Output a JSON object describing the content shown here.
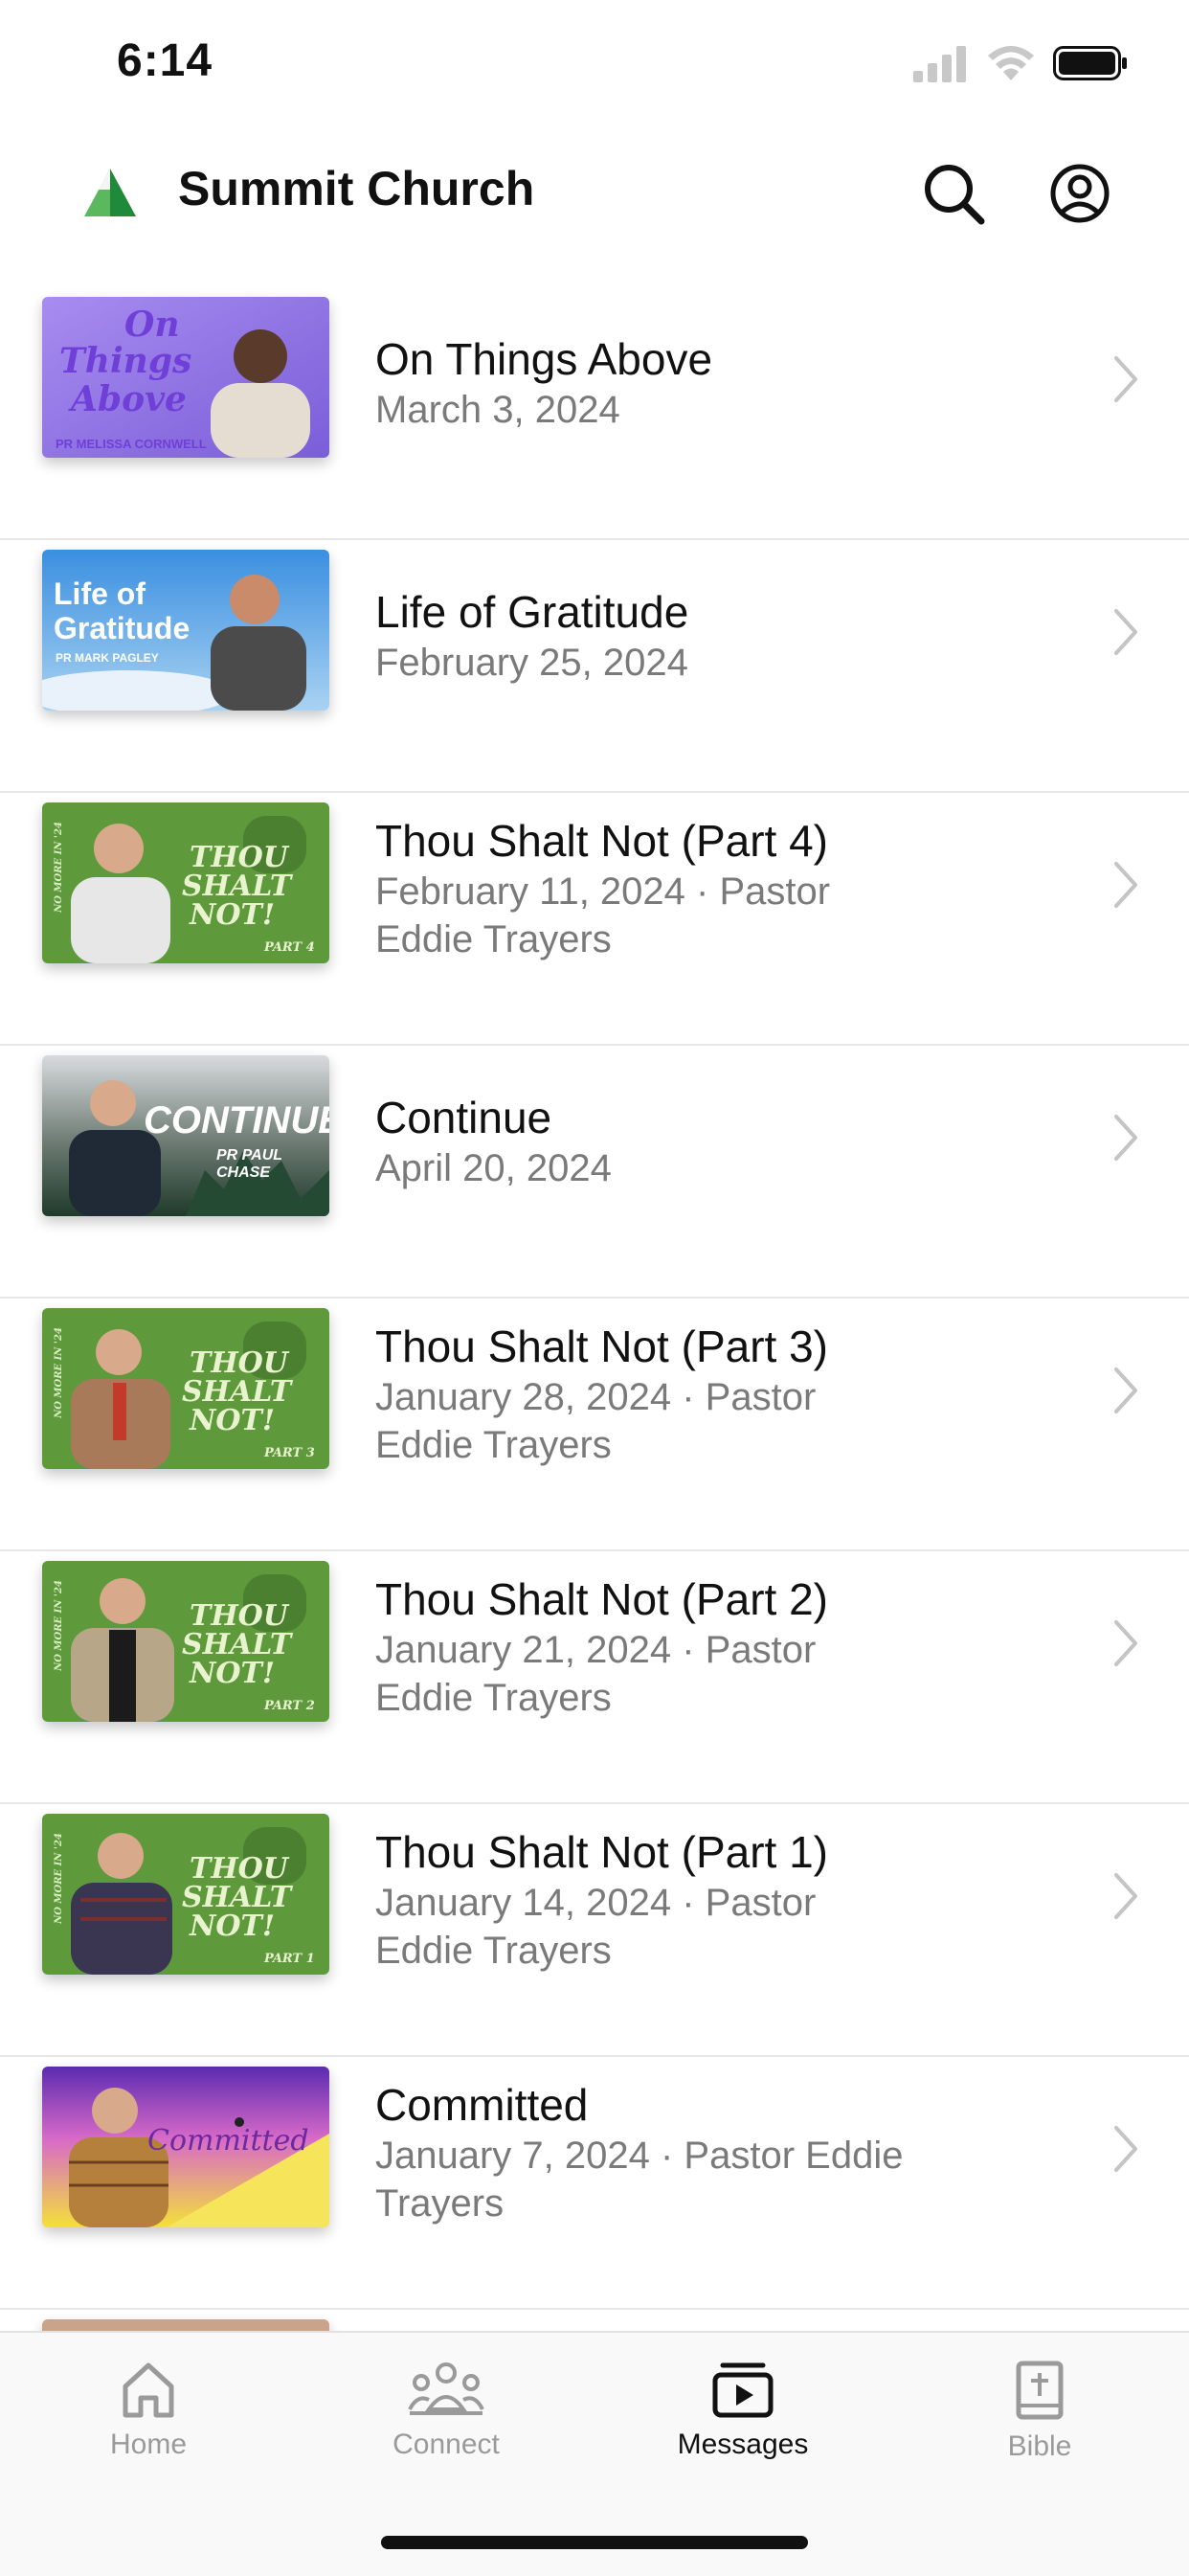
{
  "status_bar": {
    "time": "6:14"
  },
  "header": {
    "title": "Summit Church",
    "search_icon": "search-icon",
    "profile_icon": "profile-icon",
    "logo": "summit-church-logo"
  },
  "messages": [
    {
      "title": "On Things Above",
      "subtitle": "March 3, 2024",
      "thumbnail": {
        "text1": "On",
        "text2": "Things",
        "text3": "Above",
        "caption": "PR MELISSA CORNWELL"
      }
    },
    {
      "title": "Life of Gratitude",
      "subtitle": "February 25, 2024",
      "thumbnail": {
        "text1": "Life of",
        "text2": "Gratitude",
        "caption": "PR MARK PAGLEY"
      }
    },
    {
      "title": "Thou Shalt Not (Part 4)",
      "subtitle": "February 11, 2024 · Pastor Eddie Trayers",
      "thumbnail": {
        "text1": "THOU",
        "text2": "SHALT",
        "text3": "NOT!",
        "caption": "PART 4",
        "side": "NO MORE IN '24"
      }
    },
    {
      "title": "Continue",
      "subtitle": "April 20, 2024",
      "thumbnail": {
        "text1": "CONTINUE",
        "caption": "PR PAUL CHASE"
      }
    },
    {
      "title": "Thou Shalt Not (Part 3)",
      "subtitle": "January 28, 2024 · Pastor Eddie Trayers",
      "thumbnail": {
        "text1": "THOU",
        "text2": "SHALT",
        "text3": "NOT!",
        "caption": "PART 3",
        "side": "NO MORE IN '24"
      }
    },
    {
      "title": "Thou Shalt Not (Part 2)",
      "subtitle": "January 21, 2024 · Pastor Eddie Trayers",
      "thumbnail": {
        "text1": "THOU",
        "text2": "SHALT",
        "text3": "NOT!",
        "caption": "PART 2",
        "side": "NO MORE IN '24"
      }
    },
    {
      "title": "Thou Shalt Not (Part 1)",
      "subtitle": "January 14, 2024 · Pastor Eddie Trayers",
      "thumbnail": {
        "text1": "THOU",
        "text2": "SHALT",
        "text3": "NOT!",
        "caption": "PART 1",
        "side": "NO MORE IN '24"
      }
    },
    {
      "title": "Committed",
      "subtitle": "January 7, 2024 · Pastor Eddie Trayers",
      "thumbnail": {
        "text1": "Committed"
      }
    }
  ],
  "tabs": [
    {
      "label": "Home",
      "icon": "home-icon",
      "active": false
    },
    {
      "label": "Connect",
      "icon": "people-icon",
      "active": false
    },
    {
      "label": "Messages",
      "icon": "play-icon",
      "active": true
    },
    {
      "label": "Bible",
      "icon": "bible-icon",
      "active": false
    }
  ],
  "colors": {
    "logo_green": "#2e9b3a",
    "active_tab": "#111111",
    "inactive_tab": "#9a9a9a",
    "subtitle": "#7a7a7a"
  }
}
